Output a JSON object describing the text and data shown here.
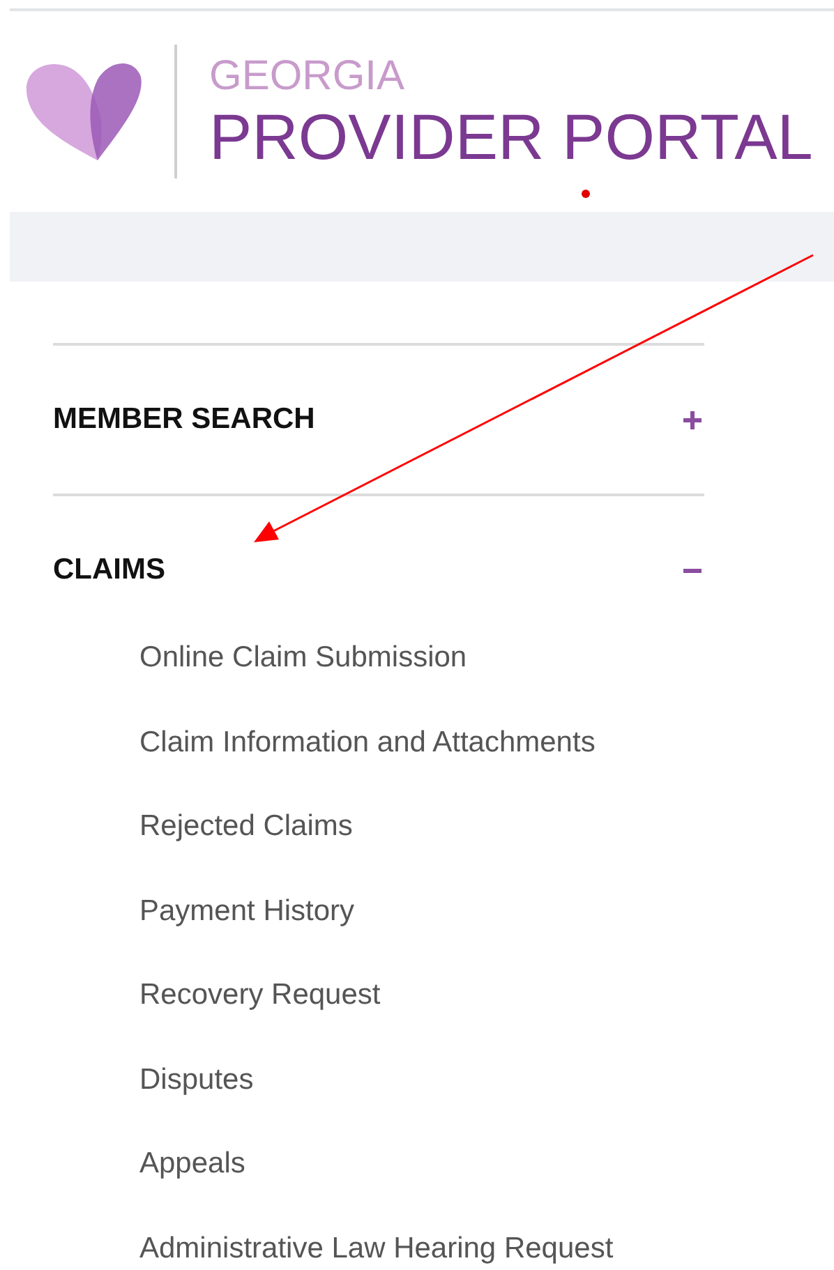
{
  "header": {
    "brand_top": "GEORGIA",
    "brand_main": "PROVIDER PORTAL"
  },
  "menu": [
    {
      "label": "MEMBER SEARCH",
      "expanded": false
    },
    {
      "label": "CLAIMS",
      "expanded": true,
      "children": [
        {
          "label": "Online Claim Submission"
        },
        {
          "label": "Claim Information and Attachments"
        },
        {
          "label": "Rejected Claims"
        },
        {
          "label": "Payment History"
        },
        {
          "label": "Recovery Request"
        },
        {
          "label": "Disputes"
        },
        {
          "label": "Appeals"
        },
        {
          "label": "Administrative Law Hearing Request"
        }
      ]
    }
  ]
}
